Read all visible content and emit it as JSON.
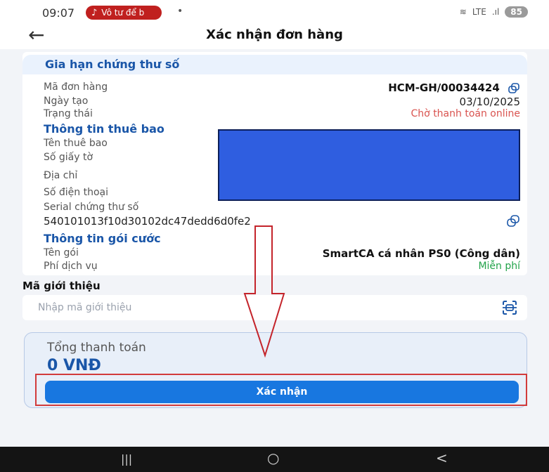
{
  "status_bar": {
    "time": "09:07",
    "notification": "Vô tư để b",
    "dot": "•",
    "signal": "LTE",
    "battery": "85"
  },
  "header": {
    "back_icon": "arrow-left-icon",
    "title": "Xác nhận đơn hàng"
  },
  "card": {
    "section1_title": "Gia hạn chứng thư số",
    "rows": [
      {
        "label": "Mã đơn hàng",
        "value": "HCM-GH/00034424"
      },
      {
        "label": "Ngày tạo",
        "value": "03/10/2025"
      },
      {
        "label": "Trạng thái",
        "value": "Chờ thanh toán online"
      }
    ],
    "section2_title": "Thông tin thuê bao",
    "subscriber_rows": [
      {
        "label": "Tên thuê bao"
      },
      {
        "label": "Số giấy tờ"
      },
      {
        "label": "Địa chỉ"
      },
      {
        "label": "Số điện thoại"
      }
    ],
    "serial_label": "Serial chứng thư số",
    "serial_value": "540101013f10d30102dc47dedd6d0fe2",
    "section3_title": "Thông tin gói cước",
    "package_rows": [
      {
        "label": "Tên gói",
        "value": "SmartCA cá nhân PS0 (Công dân)"
      },
      {
        "label": "Phí dịch vụ",
        "value": "Miễn phí"
      }
    ]
  },
  "referral": {
    "title": "Mã giới thiệu",
    "placeholder": "Nhập mã giới thiệu",
    "icon": "scan-icon"
  },
  "total": {
    "label": "Tổng thanh toán",
    "value": "0 VNĐ"
  },
  "confirm_button": "Xác nhận",
  "nav": {
    "recent": "|||",
    "home": "○",
    "back": "<"
  },
  "colors": {
    "accent": "#1a56a8",
    "button": "#1877e0",
    "status_pending": "#d9534f",
    "free": "#22a34a"
  }
}
